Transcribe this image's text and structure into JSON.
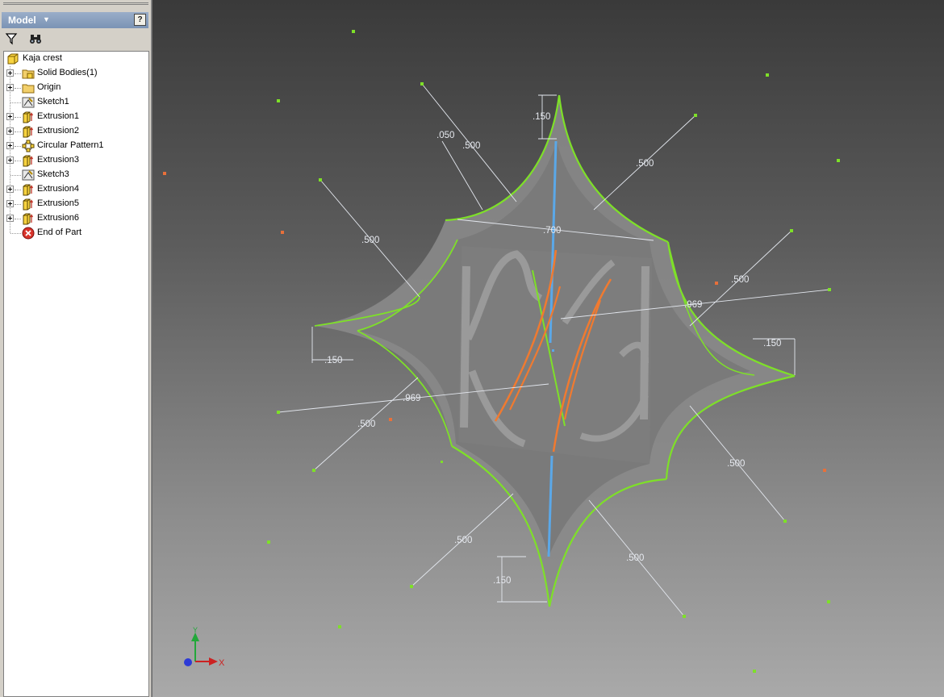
{
  "panel": {
    "title": "Model",
    "help_label": "?"
  },
  "toolbar": {
    "filter_icon": "filter-icon",
    "find_icon": "binoculars-icon"
  },
  "tree": [
    {
      "label": "Kaja crest",
      "icon": "part-icon",
      "expandable": false
    },
    {
      "label": "Solid Bodies(1)",
      "icon": "solid-bodies-folder-icon",
      "expandable": true
    },
    {
      "label": "Origin",
      "icon": "folder-icon",
      "expandable": true
    },
    {
      "label": "Sketch1",
      "icon": "sketch-icon",
      "expandable": false
    },
    {
      "label": "Extrusion1",
      "icon": "extrusion-icon",
      "expandable": true
    },
    {
      "label": "Extrusion2",
      "icon": "extrusion-icon",
      "expandable": true
    },
    {
      "label": "Circular Pattern1",
      "icon": "circular-pattern-icon",
      "expandable": true
    },
    {
      "label": "Extrusion3",
      "icon": "extrusion-icon",
      "expandable": true
    },
    {
      "label": "Sketch3",
      "icon": "sketch-icon",
      "expandable": false
    },
    {
      "label": "Extrusion4",
      "icon": "extrusion-icon",
      "expandable": true
    },
    {
      "label": "Extrusion5",
      "icon": "extrusion-icon",
      "expandable": true
    },
    {
      "label": "Extrusion6",
      "icon": "extrusion-icon",
      "expandable": true
    },
    {
      "label": "End of Part",
      "icon": "end-of-part-icon",
      "expandable": false
    }
  ],
  "dimensions": [
    ".150",
    ".050",
    ".500",
    ".500",
    ".700",
    ".500",
    ".500",
    ".969",
    ".150",
    ".150",
    ".969",
    ".500",
    ".500",
    ".500",
    ".150",
    ".500"
  ],
  "axes": {
    "x": "X",
    "y": "Y"
  },
  "colors": {
    "sketch_green": "#7ee028",
    "sketch_blue": "#5ba8e8",
    "sketch_orange": "#f07a30",
    "tree_text": "#000000",
    "panel_header": "#7b93b5"
  }
}
